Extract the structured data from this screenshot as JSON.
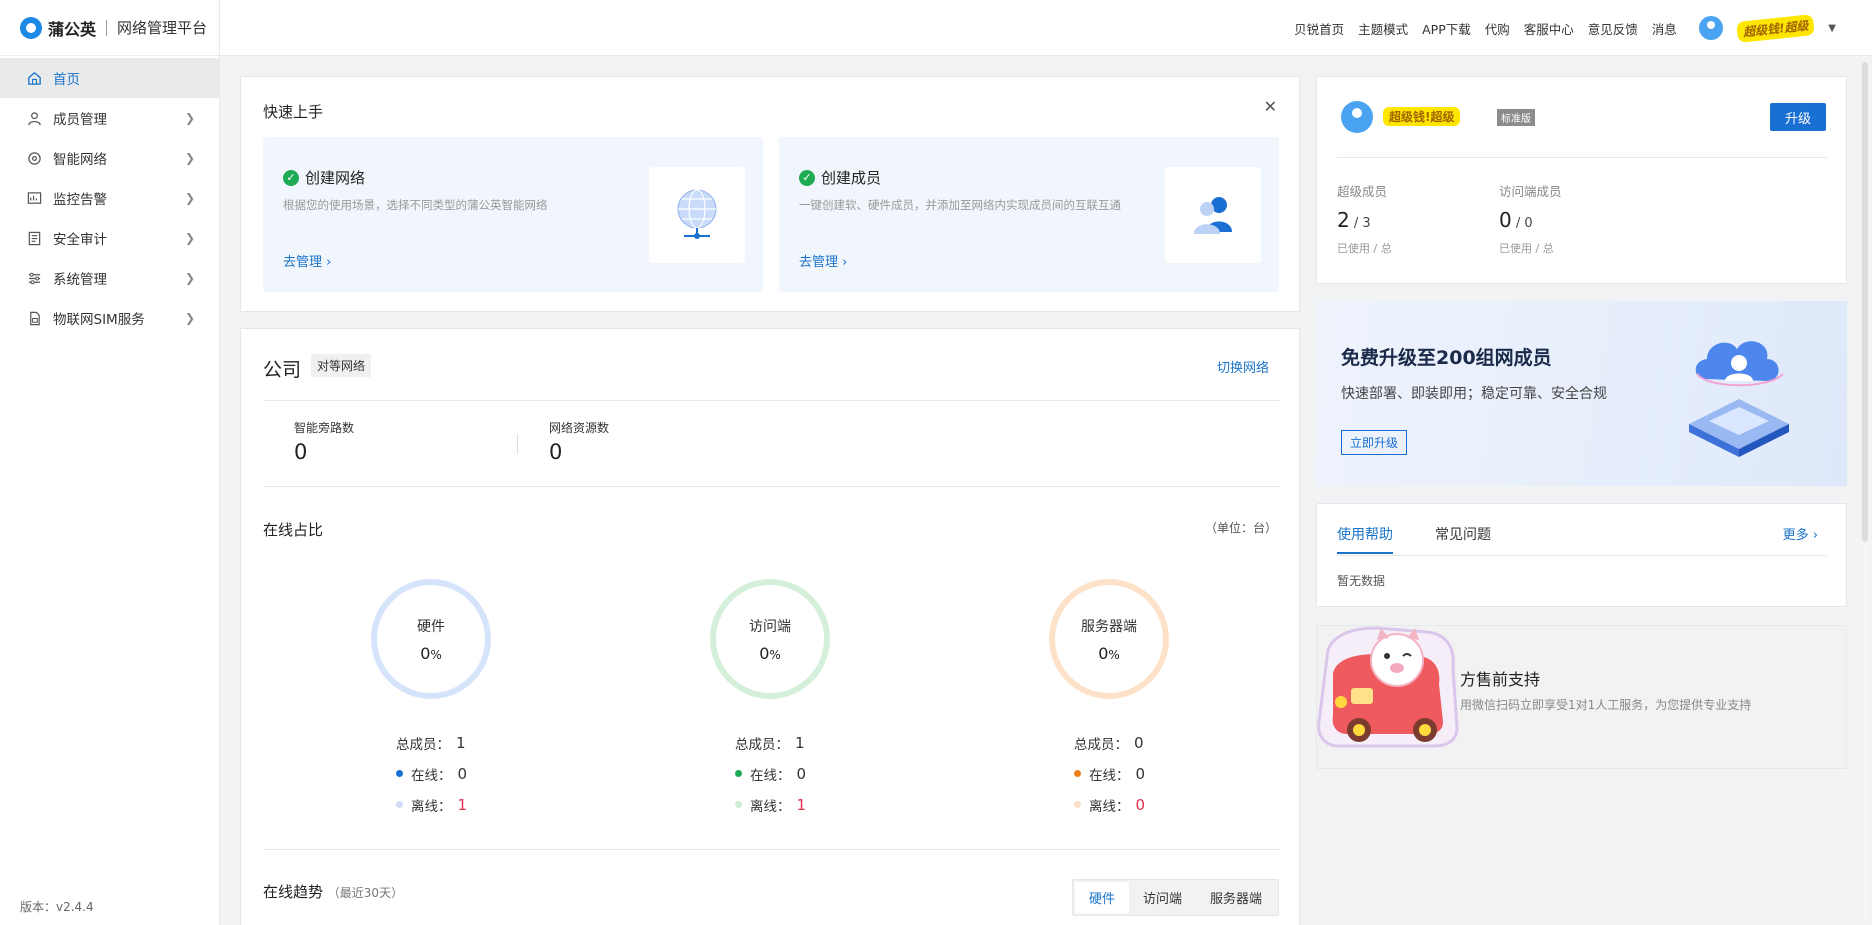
{
  "brand": {
    "name": "蒲公英",
    "subtitle": "网络管理平台"
  },
  "sidebar": {
    "items": [
      {
        "label": "首页",
        "icon": "home-icon",
        "active": true
      },
      {
        "label": "成员管理",
        "icon": "user-icon"
      },
      {
        "label": "智能网络",
        "icon": "network-icon"
      },
      {
        "label": "监控告警",
        "icon": "monitor-icon"
      },
      {
        "label": "安全审计",
        "icon": "audit-icon"
      },
      {
        "label": "系统管理",
        "icon": "settings-icon"
      },
      {
        "label": "物联网SIM服务",
        "icon": "sim-icon"
      }
    ],
    "version": "版本：v2.4.4"
  },
  "topnav": {
    "links": [
      "贝锐首页",
      "主题模式",
      "APP下载",
      "代购",
      "客服中心",
      "意见反馈",
      "消息"
    ],
    "user_name": "超级钱!超级"
  },
  "quick_start": {
    "title": "快速上手",
    "panels": [
      {
        "title": "创建网络",
        "desc": "根据您的使用场景，选择不同类型的蒲公英智能网络",
        "link": "去管理"
      },
      {
        "title": "创建成员",
        "desc": "一键创建软、硬件成员，并添加至网络内实现成员间的互联互通",
        "link": "去管理"
      }
    ]
  },
  "network": {
    "name": "公司",
    "type_tag": "对等网络",
    "switch_label": "切换网络",
    "stats": [
      {
        "label": "智能旁路数",
        "value": "0"
      },
      {
        "label": "网络资源数",
        "value": "0"
      }
    ],
    "online_title": "在线占比",
    "unit": "（单位：台）",
    "rings": [
      {
        "name": "硬件",
        "pct": "0",
        "pct_unit": "%",
        "color": "#d6e4fb",
        "dot_on": "#1a6fd3",
        "dot_off": "#cfdcf7",
        "total_label": "总成员：",
        "total": "1",
        "online_label": "在线：",
        "online": "0",
        "offline_label": "离线：",
        "offline": "1"
      },
      {
        "name": "访问端",
        "pct": "0",
        "pct_unit": "%",
        "color": "#d5f0da",
        "dot_on": "#1fab54",
        "dot_off": "#cdeed5",
        "total_label": "总成员：",
        "total": "1",
        "online_label": "在线：",
        "online": "0",
        "offline_label": "离线：",
        "offline": "1"
      },
      {
        "name": "服务器端",
        "pct": "0",
        "pct_unit": "%",
        "color": "#fde2c9",
        "dot_on": "#f07d1a",
        "dot_off": "#fbe0c6",
        "total_label": "总成员：",
        "total": "0",
        "online_label": "在线：",
        "online": "0",
        "offline_label": "离线：",
        "offline": "0"
      }
    ],
    "trend_title": "在线趋势",
    "trend_sub": "（最近30天）",
    "trend_tabs": [
      "硬件",
      "访问端",
      "服务器端"
    ]
  },
  "account": {
    "name": "超级钱!超级",
    "badge": "标准版",
    "upgrade": "升级",
    "stats": [
      {
        "label": "超级成员",
        "used": "2",
        "sep": " / ",
        "total": "3",
        "sub": "已使用 / 总"
      },
      {
        "label": "访问端成员",
        "used": "0",
        "sep": " / ",
        "total": "0",
        "sub": "已使用 / 总"
      }
    ]
  },
  "promo": {
    "title": "免费升级至200组网成员",
    "subtitle": "快速部署、即装即用；稳定可靠、安全合规",
    "button": "立即升级"
  },
  "help": {
    "tabs": [
      "使用帮助",
      "常见问题"
    ],
    "more": "更多",
    "empty": "暂无数据"
  },
  "support": {
    "title": "方售前支持",
    "subtitle": "用微信扫码立即享受1对1人工服务，为您提供专业支持"
  },
  "colors": {
    "accent": "#1a73c8",
    "primary_button": "#1a6fd3",
    "success": "#1fab54"
  }
}
